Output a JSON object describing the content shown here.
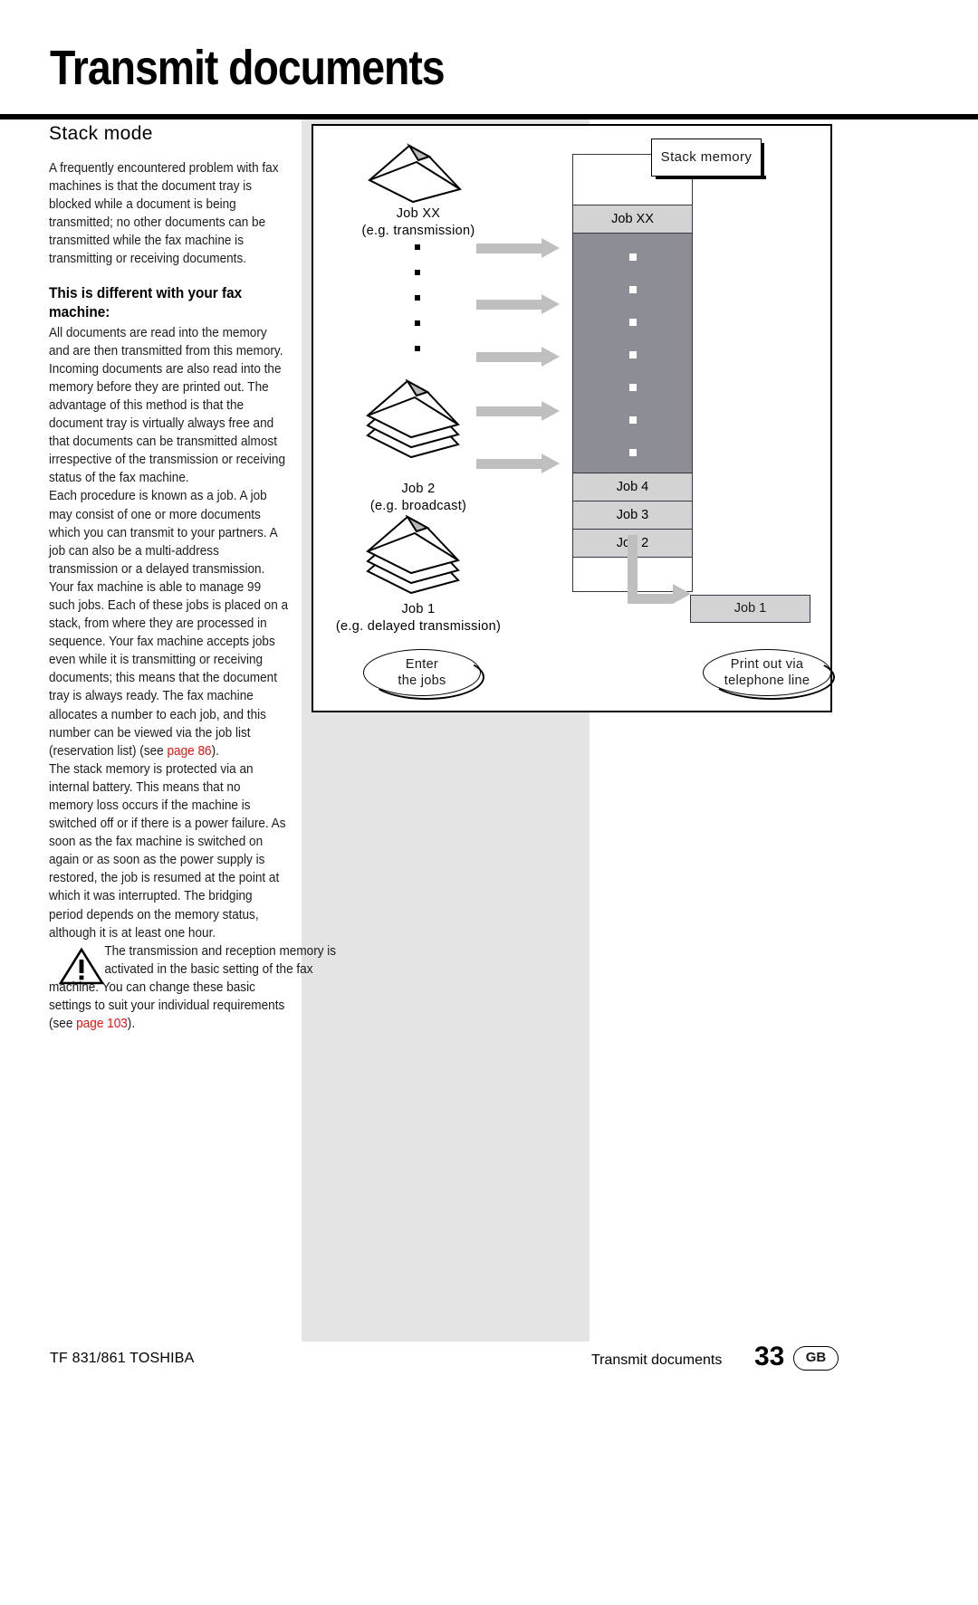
{
  "header": {
    "title": "Transmit documents"
  },
  "left_column": {
    "section_heading": "Stack mode",
    "paragraph_1": "A frequently encountered problem with fax machines is that the document tray is blocked while a document is being transmitted; no other documents can be transmitted while the fax machine is transmitting or receiving documents.",
    "sub_heading": "This is different with your fax machine:",
    "paragraph_2": "All documents are read into the memory and are then transmitted from this memory. Incoming documents are also read into the memory before they are printed out. The advantage of this method is that the document tray is virtually always free and that documents can be transmitted almost irrespective of the transmission or receiving status of the fax machine.",
    "paragraph_3": "Each procedure is known as a job. A job may consist of one or more documents which you can transmit to your partners. A job can also be a multi-address transmission or a delayed transmission. Your fax machine is able to manage 99 such jobs. Each of these jobs is placed on a stack, from where they are processed in sequence. Your fax machine accepts jobs even while it is transmitting or receiving documents; this means that the document tray is always ready. The fax machine allocates a number to each job, and this number can be viewed via the job list (reservation list) (see ",
    "xref_1": "page 86",
    "paragraph_3_tail": ").",
    "paragraph_4": "The stack memory is protected via an internal battery. This means that no memory loss occurs if the machine is switched off or if there is a power failure. As soon as the fax machine is switched on again or as soon as the power supply is restored, the job is resumed at the point at which it was interrupted. The bridging period depends on the memory status, although it is at least one hour.",
    "warning": {
      "icon": "warning-triangle-icon",
      "text_indented": "The transmission and reception memory is activated in the basic setting of the fax",
      "text_continued_pre": "machine. You can change these basic settings to suit your individual requirements (see ",
      "xref_2": "page 103",
      "text_continued_post": ")."
    }
  },
  "diagram": {
    "callout_stack_memory": "Stack memory",
    "jobs_in": [
      {
        "name": "Job XX",
        "detail": "(e.g. transmission)"
      },
      {
        "name": "Job 2",
        "detail": "(e.g. broadcast)"
      },
      {
        "name": "Job 1",
        "detail": "(e.g. delayed transmission)"
      }
    ],
    "stack_cells": [
      {
        "label": "Job XX",
        "style": "light"
      },
      {
        "label": "",
        "style": "dark"
      },
      {
        "label": "Job 4",
        "style": "light"
      },
      {
        "label": "Job 3",
        "style": "light"
      },
      {
        "label": "Job 2",
        "style": "light"
      },
      {
        "label": "",
        "style": "empty"
      }
    ],
    "output_box": "Job 1",
    "oval_left_line1": "Enter",
    "oval_left_line2": "the jobs",
    "oval_right_line1": "Print out via",
    "oval_right_line2": "telephone line",
    "colors": {
      "stack_fill_dark": "#8d8d95",
      "stack_fill_light": "#d3d3d3",
      "arrow_grey": "#bfbfbf",
      "band_grey": "#e4e4e4"
    }
  },
  "footer": {
    "left": "TF 831/861 TOSHIBA",
    "middle": "Transmit documents",
    "page_number": "33",
    "locale_badge": "GB"
  }
}
